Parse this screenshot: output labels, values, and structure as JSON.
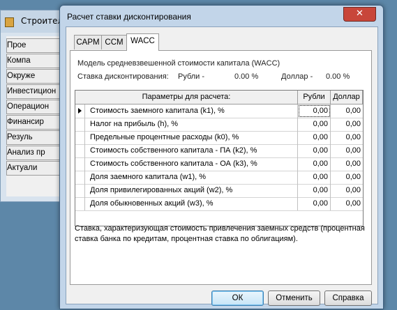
{
  "background_window": {
    "title": "Строитель",
    "buttons": [
      "Прое",
      "Компа",
      "Окруже",
      "Инвестицион",
      "Операцион",
      "Финансир",
      "Резуль",
      "Анализ пр",
      "Актуали"
    ]
  },
  "dialog": {
    "title": "Расчет ставки дисконтирования",
    "close_symbol": "✕"
  },
  "tabs": [
    {
      "label": "CAPM",
      "active": false
    },
    {
      "label": "CCM",
      "active": false
    },
    {
      "label": "WACC",
      "active": true
    }
  ],
  "panel": {
    "model_title": "Модель средневзвешенной стоимости капитала (WACC)",
    "rate_label": "Ставка дисконтирования:",
    "rub_label": "Рубли -",
    "rub_value": "0.00 %",
    "usd_label": "Доллар -",
    "usd_value": "0.00 %"
  },
  "grid": {
    "headers": {
      "param": "Параметры для расчета:",
      "rub": "Рубли",
      "usd": "Доллар"
    },
    "rows": [
      {
        "param": "Стоимость заемного капитала (k1), %",
        "rub": "0,00",
        "usd": "0,00"
      },
      {
        "param": "Налог на прибыль (h), %",
        "rub": "0,00",
        "usd": "0,00"
      },
      {
        "param": "Предельные процентные расходы (k0), %",
        "rub": "0,00",
        "usd": "0,00"
      },
      {
        "param": "Стоимость собственного капитала - ПА (k2), %",
        "rub": "0,00",
        "usd": "0,00"
      },
      {
        "param": "Стоимость собственного капитала - ОА (k3), %",
        "rub": "0,00",
        "usd": "0,00"
      },
      {
        "param": "Доля заемного капитала (w1), %",
        "rub": "0,00",
        "usd": "0,00"
      },
      {
        "param": "Доля привилегированных акций (w2), %",
        "rub": "0,00",
        "usd": "0,00"
      },
      {
        "param": "Доля обыкновенных акций (w3), %",
        "rub": "0,00",
        "usd": "0,00"
      }
    ]
  },
  "description": "Ставка, характеризующая стоимость привлечения заемных средств (процентная ставка банка по кредитам, процентная ставка по облигациям).",
  "footer": {
    "ok": "ОК",
    "cancel": "Отменить",
    "help": "Справка"
  },
  "colors": {
    "title_bar": "#c2d5e9",
    "desktop": "#5d87a8",
    "close_button": "#c8463a"
  }
}
